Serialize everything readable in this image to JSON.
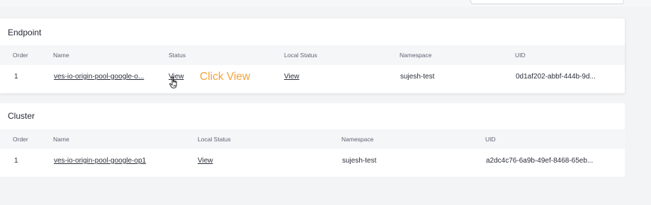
{
  "endpoint": {
    "title": "Endpoint",
    "columns": [
      "Order",
      "Name",
      "Status",
      "Local Status",
      "Namespace",
      "UID"
    ],
    "rows": [
      {
        "order": "1",
        "name": "ves-io-origin-pool-google-o...",
        "status": "View",
        "local_status": "View",
        "namespace": "sujesh-test",
        "uid": "0d1af202-abbf-444b-9d..."
      }
    ]
  },
  "annotation": "Click View",
  "cluster": {
    "title": "Cluster",
    "columns": [
      "Order",
      "Name",
      "Local Status",
      "Namespace",
      "UID"
    ],
    "rows": [
      {
        "order": "1",
        "name": "ves-io-origin-pool-google-op1",
        "local_status": "View",
        "namespace": "sujesh-test",
        "uid": "a2dc4c76-6a9b-49ef-8468-65eb..."
      }
    ]
  },
  "colors": {
    "annotation": "#f5a23a",
    "background": "#f3f4f6",
    "card": "#ffffff",
    "header_row": "#f5f6f8"
  },
  "icons": {
    "cursor": "hand-pointer-icon"
  }
}
